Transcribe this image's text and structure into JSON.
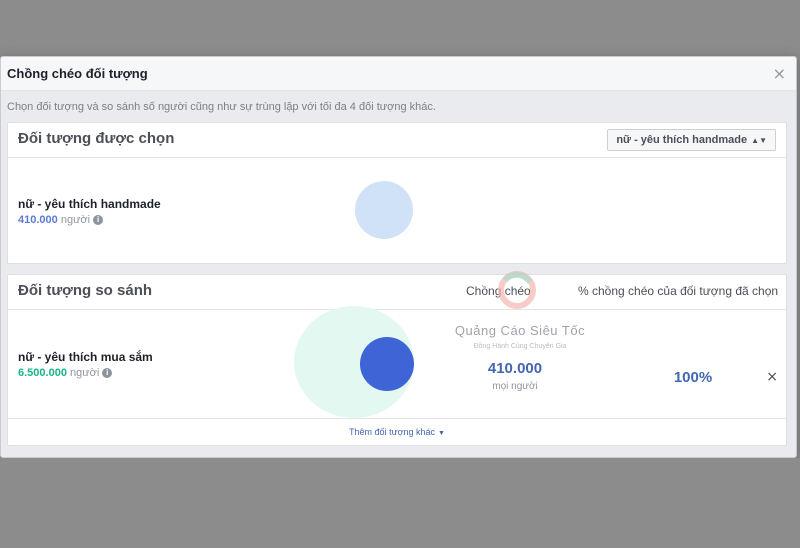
{
  "dialog": {
    "title": "Chồng chéo đối tượng",
    "close_symbol": "×",
    "description": "Chọn đối tượng và so sánh số người cũng như sự trùng lặp với tối đa 4 đối tượng khác."
  },
  "selected": {
    "title": "Đối tượng được chọn",
    "dropdown_value": "nữ - yêu thích handmade",
    "dropdown_icon": "sort-arrows-icon",
    "audience": {
      "name": "nữ - yêu thích handmade",
      "size": "410.000",
      "unit": "người"
    },
    "circle_color": "#cfe2f8"
  },
  "compare": {
    "title": "Đối tượng so sánh",
    "col_overlap": "Chồng chéo",
    "col_percent": "% chồng chéo của đối tượng đã chọn",
    "rows": [
      {
        "name": "nữ - yêu thích mua sắm",
        "size": "6.500.000",
        "unit": "người",
        "overlap": "410.000",
        "overlap_unit": "mọi người",
        "percent": "100%",
        "remove_symbol": "×"
      }
    ],
    "big_circle_color": "#e3f8f1",
    "small_circle_color": "#3e64d6",
    "add_link": "Thêm đối tượng khác"
  },
  "watermark": {
    "text": "Quảng Cáo Siêu Tốc",
    "subtext": "Đồng Hành Cùng Chuyên Gia"
  },
  "colors": {
    "accent": "#4267b2",
    "green": "#18b38a"
  }
}
